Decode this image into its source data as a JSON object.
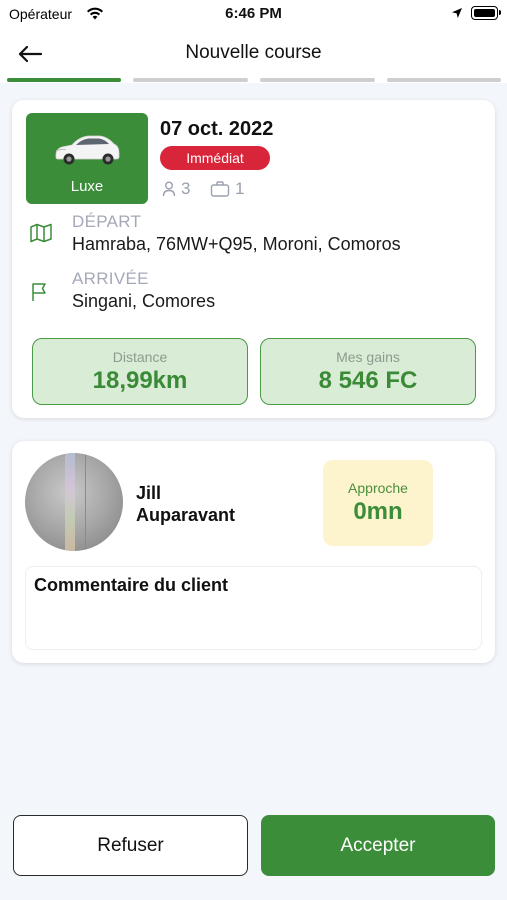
{
  "status_bar": {
    "carrier": "Opérateur",
    "time": "6:46 PM"
  },
  "header": {
    "title": "Nouvelle course",
    "back_icon": "arrow-left-icon"
  },
  "progress": {
    "steps_total": 4,
    "step_current": 1,
    "active_color": "#3c8d3a",
    "inactive_color": "#cfcfcf"
  },
  "ride": {
    "vehicle_class": "Luxe",
    "date": "07 oct. 2022",
    "type_badge": "Immédiat",
    "passengers": "3",
    "luggage": "1",
    "departure": {
      "label": "DÉPART",
      "address": "Hamraba, 76MW+Q95, Moroni, Comoros"
    },
    "arrival": {
      "label": "ARRIVÉE",
      "address": "Singani, Comores"
    },
    "distance": {
      "label": "Distance",
      "value": "18,99km"
    },
    "earnings": {
      "label": "Mes gains",
      "value": "8 546 FC"
    }
  },
  "client": {
    "first_name": "Jill",
    "last_name": "Auparavant",
    "approach": {
      "label": "Approche",
      "value": "0mn"
    },
    "comment_title": "Commentaire du client"
  },
  "actions": {
    "refuse": "Refuser",
    "accept": "Accepter"
  },
  "colors": {
    "brand_green": "#3c8d3a",
    "badge_red": "#d8253a",
    "stat_bg": "#d9ecd6",
    "approach_bg": "#fdf3cc"
  }
}
